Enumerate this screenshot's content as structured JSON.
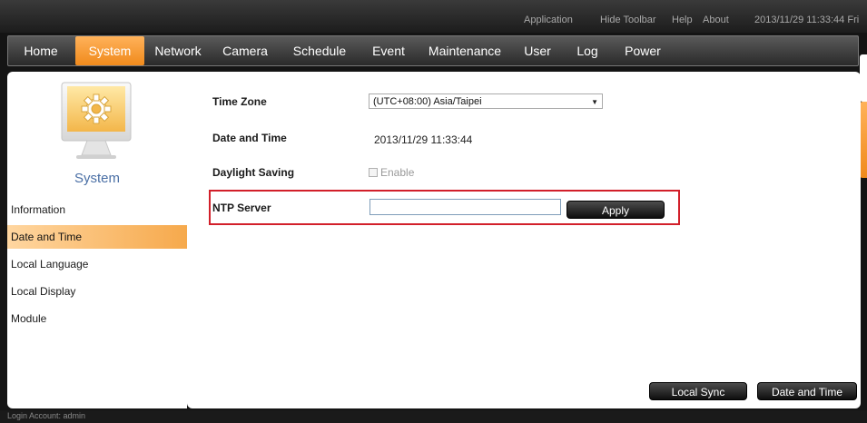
{
  "topbar": {
    "links": [
      "Application",
      "Hide Toolbar",
      "Help",
      "About"
    ],
    "datetime": "2013/11/29 11:33:44 Fri"
  },
  "nav": {
    "items": [
      "Home",
      "System",
      "Network",
      "Camera",
      "Schedule",
      "Event",
      "Maintenance",
      "User",
      "Log",
      "Power"
    ],
    "active": "System"
  },
  "sidebar": {
    "title": "System",
    "items": [
      "Information",
      "Date and Time",
      "Local Language",
      "Local Display",
      "Module"
    ],
    "active": "Date and Time"
  },
  "form": {
    "timezone_label": "Time Zone",
    "timezone_value": "(UTC+08:00) Asia/Taipei",
    "datetime_label": "Date and Time",
    "datetime_value": "2013/11/29 11:33:44",
    "dst_label": "Daylight Saving",
    "dst_checkbox_label": "Enable",
    "ntp_label": "NTP Server",
    "ntp_value": "",
    "apply_label": "Apply"
  },
  "actions": {
    "local_sync_label": "Local Sync",
    "date_time_label": "Date and Time"
  },
  "footer": {
    "login_text": "Login Account: admin"
  },
  "colors": {
    "accent_orange": "#f08a1c",
    "highlight_red": "#d21f2a",
    "sidebar_title_blue": "#4a6fa5"
  }
}
